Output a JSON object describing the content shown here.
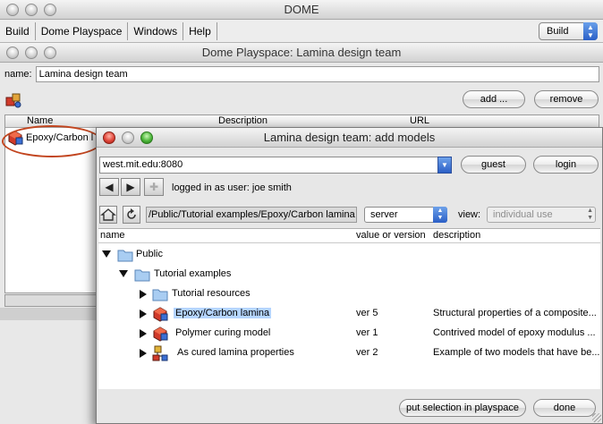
{
  "dome_window": {
    "title": "DOME",
    "menu": [
      "Build",
      "Dome Playspace",
      "Windows",
      "Help"
    ],
    "mode_select": "Build"
  },
  "playspace_window": {
    "title": "Dome Playspace: Lamina design team",
    "name_label": "name:",
    "name_value": "Lamina design team",
    "add_label": "add ...",
    "remove_label": "remove",
    "columns": [
      "Name",
      "Description",
      "URL"
    ],
    "row_name": "Epoxy/Carbon l"
  },
  "add_models_dialog": {
    "title": "Lamina design team: add models",
    "server_url": "west.mit.edu:8080",
    "guest_label": "guest",
    "login_label": "login",
    "logged_in_text": "logged in as user: joe smith",
    "path": "/Public/Tutorial examples/Epoxy/Carbon lamina",
    "location_select": "server",
    "view_label": "view:",
    "view_select": "individual use",
    "columns": [
      "name",
      "value or version",
      "description"
    ],
    "tree": [
      {
        "name": "Public",
        "version": "",
        "description": "",
        "icon": "folder-icon",
        "expanded": true
      },
      {
        "name": "Tutorial examples",
        "version": "",
        "description": "",
        "icon": "folder-icon",
        "expanded": true
      },
      {
        "name": "Tutorial resources",
        "version": "",
        "description": "",
        "icon": "folder-icon",
        "expanded": false
      },
      {
        "name": "Epoxy/Carbon lamina",
        "version": "ver 5",
        "description": "Structural properties of a composite...",
        "icon": "model-icon",
        "selected": true
      },
      {
        "name": "Polymer curing model",
        "version": "ver 1",
        "description": "Contrived model  of epoxy modulus ...",
        "icon": "model-icon"
      },
      {
        "name": "As cured lamina properties",
        "version": "ver 2",
        "description": "Example of two models that have be...",
        "icon": "integration-model-icon"
      }
    ],
    "put_selection_label": "put selection in playspace",
    "done_label": "done"
  },
  "colors": {
    "selection": "#b5d5ff",
    "aqua_blue": "#2b5fc6",
    "annotation_red": "#c2451f"
  }
}
